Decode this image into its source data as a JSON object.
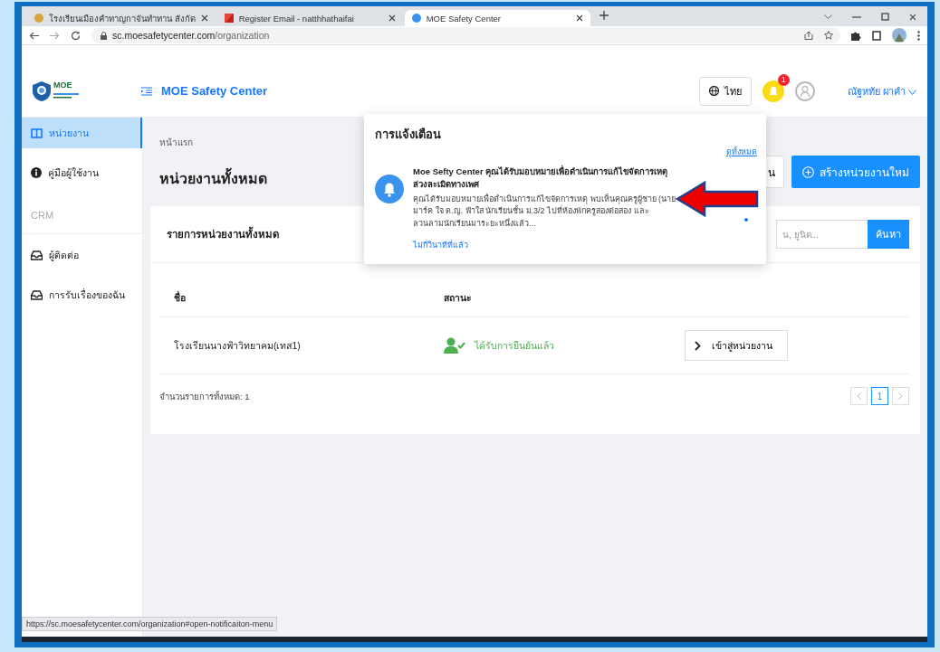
{
  "browser": {
    "tabs": [
      {
        "title": "โรงเรียนเมืองคำทาญกาจันทำทาน สังกัด",
        "selected": false
      },
      {
        "title": "Register Email - natthhathaifai",
        "selected": false
      },
      {
        "title": "MOE Safety Center",
        "selected": true
      }
    ],
    "url_domain": "sc.moesafetycenter.com",
    "url_path": "/organization",
    "status_url": "https://sc.moesafetycenter.com/organization#open-notificaiton-menu"
  },
  "header": {
    "logo_text": "MOE",
    "app_title": "MOE Safety Center",
    "language": "ไทย",
    "notification_count": "1",
    "user_name": "ณัฐหทัย ผาคำ"
  },
  "sidebar": {
    "items": [
      {
        "kind": "table",
        "label": "หน่วยงาน",
        "selected": true
      },
      {
        "kind": "info",
        "label": "คู่มือผู้ใช้งาน",
        "selected": false
      },
      {
        "kind": "section",
        "label": "CRM"
      },
      {
        "kind": "inbox",
        "label": "ผู้ติดต่อ",
        "selected": false
      },
      {
        "kind": "inbox",
        "label": "การรับเรื่องของฉัน",
        "selected": false
      }
    ]
  },
  "page": {
    "breadcrumb": "หน้าแรก",
    "title": "หน่วยงานทั้งหมด",
    "partial_button": "น",
    "create_button": "สร้างหน่วยงานใหม่",
    "card_title": "รายการหน่วยงานทั้งหมด",
    "search": {
      "placeholder": "น, ยูนิต..."
    },
    "search_button": "ค้นหา",
    "table": {
      "columns": [
        "ชื่อ",
        "สถานะ"
      ],
      "rows": [
        {
          "name": "โรงเรียนนางฟ้าวิทยาคม(เทส1)",
          "status": "ได้รับการยืนยันแล้ว",
          "verified": true,
          "action": "เข้าสู่หน่วยงาน"
        }
      ]
    },
    "total": "จำนวนรายการทั้งหมด: 1",
    "pages": [
      {
        "label": "1",
        "selected": true
      }
    ]
  },
  "notifications": {
    "title": "การแจ้งเตือน",
    "view_all": "ดูทั้งหมด",
    "items": [
      {
        "title": "Moe Sefty Center คุณได้รับมอบหมายเพื่อดำเนินการแก้ไขจัดการเหตุ ล่วงละเมิดทางเพศ",
        "body": "คุณได้รับมอบหมายเพื่อดำเนินการแก้ไขจัดการเหตุ พบเห็นคุณครูผู้ชาย (นายมาร์ค ใจ ด.ญ. ฟ้าใส นักเรียนชั้น ม.3/2 ไปที่ห้องพักครูสองต่อสอง และลวนลามนักเรียนมาระยะหนึ่งแล้ว...",
        "time": "ไม่กี่วินาทีที่แล้ว",
        "unread": true
      }
    ]
  }
}
